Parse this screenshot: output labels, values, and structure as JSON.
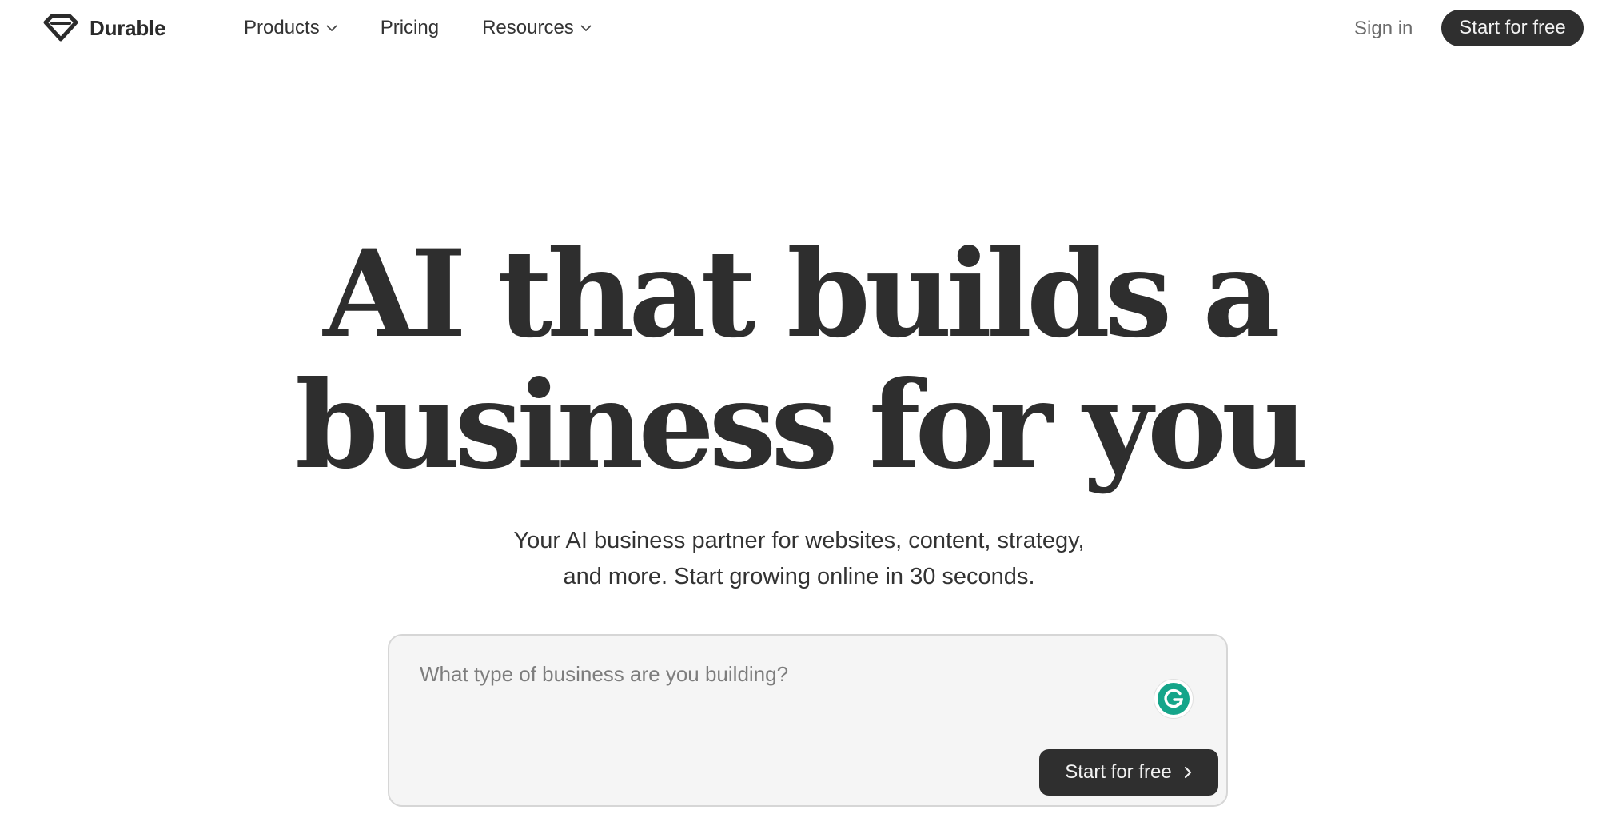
{
  "brand": {
    "name": "Durable",
    "logo_icon": "durable-diamond-logo"
  },
  "nav": {
    "items": [
      {
        "label": "Products",
        "has_dropdown": true
      },
      {
        "label": "Pricing",
        "has_dropdown": false
      },
      {
        "label": "Resources",
        "has_dropdown": true
      }
    ],
    "sign_in_label": "Sign in",
    "cta_label": "Start for free"
  },
  "hero": {
    "title_line1": "AI that builds a",
    "title_line2": "business for you",
    "subtitle_line1": "Your AI business partner for websites, content, strategy,",
    "subtitle_line2": "and more. Start growing online in 30 seconds."
  },
  "prompt": {
    "placeholder": "What type of business are you building?",
    "value": "",
    "submit_label": "Start for free",
    "assistant_icon": "grammarly-icon"
  },
  "colors": {
    "text": "#2f2f2f",
    "button_bg": "#2f2f2f",
    "button_text": "#f2f2f2",
    "prompt_bg": "#f5f5f5",
    "prompt_border": "#d6d6d6",
    "grammarly_green": "#15a58a"
  }
}
